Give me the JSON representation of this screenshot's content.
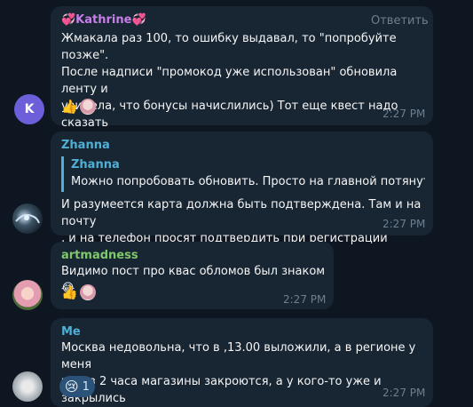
{
  "messages": [
    {
      "sender": "💞Kathrine💞",
      "reply_label": "Ответить",
      "lines": "Жмакала раз 100, то ошибку выдавал, то \"попробуйте позже\".\nПосле надписи \"промокод уже использован\" обновила ленту и\nувидела, что бонусы начислились) Тот еще квест надо сказать\n😭 Остальным удачи и крепких нервов ✊",
      "reactions": [
        "👍"
      ],
      "time": "2:27 PM",
      "avatar_letter": "K",
      "colors": {
        "name": "#c77fe8",
        "avatar_bg": "#6c5fd9"
      }
    },
    {
      "sender": "Zhanna",
      "quote_name": "Zhanna",
      "quote_text": "Можно попробовать обновить. Просто на главной потянуть ...",
      "lines": "И разумеется карта должна быть подтверждена. Там и на почту\n, и на телефон просят подтвердить при регистрации",
      "time": "2:27 PM",
      "colors": {
        "name": "#4fb0d6"
      }
    },
    {
      "sender": "artmadness",
      "lines": "Видимо пост про квас обломов был знаком😂",
      "reactions": [
        "👍"
      ],
      "time": "2:27 PM",
      "colors": {
        "name": "#7fc96a"
      }
    },
    {
      "sender": "Me",
      "lines": "Москва недовольна, что в  ,13.00 выложили, а в регионе у меня\nчерез 2 часа магазины закроются, а у кого-то уже и закрылись",
      "reaction_emoji": "😢",
      "reaction_count": "1",
      "time": "2:27 PM",
      "colors": {
        "name": "#4fb0d6"
      }
    }
  ]
}
